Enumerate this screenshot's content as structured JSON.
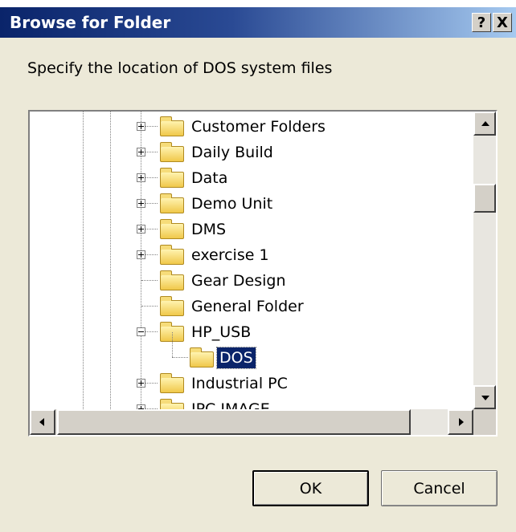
{
  "dialog": {
    "title": "Browse for Folder",
    "help_label": "?",
    "close_label": "X",
    "prompt": "Specify the location of DOS system files"
  },
  "tree": {
    "items": [
      {
        "label": "Customer Folders",
        "expander": "plus"
      },
      {
        "label": "Daily Build",
        "expander": "plus"
      },
      {
        "label": "Data",
        "expander": "plus"
      },
      {
        "label": "Demo Unit",
        "expander": "plus"
      },
      {
        "label": "DMS",
        "expander": "plus"
      },
      {
        "label": "exercise 1",
        "expander": "plus"
      },
      {
        "label": "Gear Design",
        "expander": "none"
      },
      {
        "label": "General Folder",
        "expander": "none"
      },
      {
        "label": "HP_USB",
        "expander": "minus"
      },
      {
        "label": "DOS",
        "expander": "none",
        "child": true,
        "selected": true
      },
      {
        "label": "Industrial PC",
        "expander": "plus"
      },
      {
        "label": "IPC IMAGE",
        "expander": "plus"
      }
    ],
    "selected_label": "DOS"
  },
  "buttons": {
    "ok": "OK",
    "cancel": "Cancel"
  },
  "colors": {
    "selection": "#0a246a",
    "titlebar_start": "#0a246a",
    "titlebar_end": "#a6caf0",
    "folder": "#f0c84a"
  },
  "icons": [
    "folder-icon",
    "expand-icon",
    "collapse-icon",
    "scroll-up-icon",
    "scroll-down-icon",
    "scroll-left-icon",
    "scroll-right-icon"
  ]
}
